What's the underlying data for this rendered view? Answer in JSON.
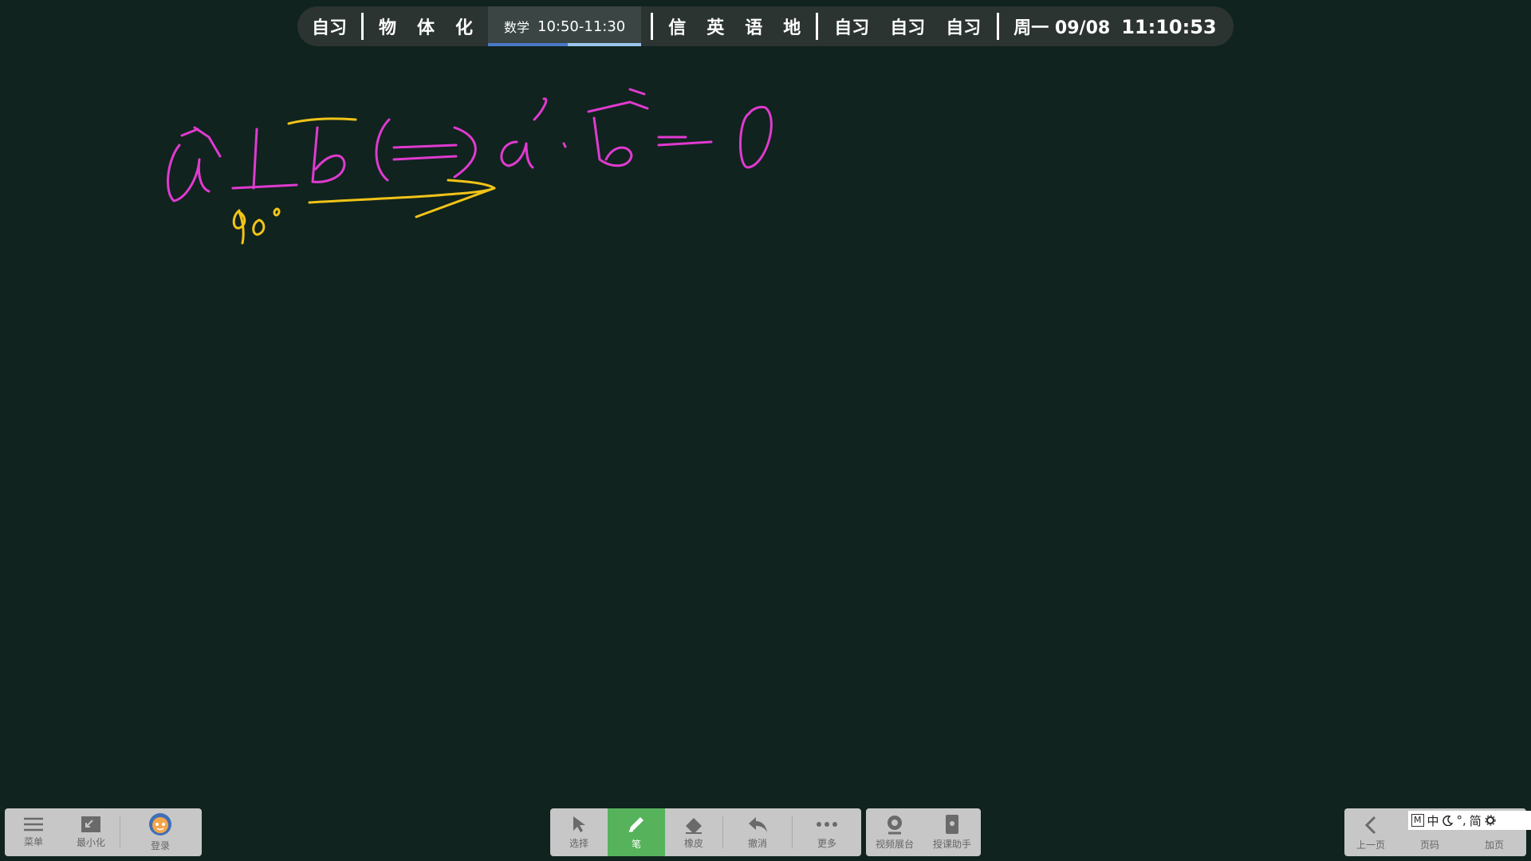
{
  "schedule": {
    "items_before": [
      "自习",
      "物",
      "体",
      "化"
    ],
    "current": {
      "subject": "数学",
      "time": "10:50-11:30",
      "progress": 0.52
    },
    "items_after": [
      "信",
      "英",
      "语",
      "地"
    ],
    "items_evening": [
      "自习",
      "自习",
      "自习"
    ],
    "date": "周一 09/08",
    "clock": "11:10:53"
  },
  "ink_colors": {
    "pink": "#e03ad0",
    "yellow": "#f2c418"
  },
  "left_toolbar": {
    "menu": {
      "label": "菜单",
      "icon": "hamburger-icon"
    },
    "minimize": {
      "label": "最小化",
      "icon": "minimize-icon"
    },
    "login": {
      "label": "登录",
      "icon": "avatar-icon"
    }
  },
  "center_toolbar": {
    "select": {
      "label": "选择",
      "icon": "cursor-icon"
    },
    "pen": {
      "label": "笔",
      "icon": "pen-icon",
      "active": true
    },
    "eraser": {
      "label": "橡皮",
      "icon": "eraser-icon"
    },
    "undo": {
      "label": "撤消",
      "icon": "undo-icon"
    },
    "more": {
      "label": "更多",
      "icon": "more-icon"
    },
    "camera": {
      "label": "视频展台",
      "icon": "webcam-icon"
    },
    "assistant": {
      "label": "授课助手",
      "icon": "phone-icon"
    }
  },
  "right_toolbar": {
    "prev": {
      "label": "上一页",
      "icon": "chevron-left-icon"
    },
    "page": {
      "label": "页码"
    },
    "add": {
      "label": "加页"
    }
  },
  "ime": {
    "mode": "M",
    "lang": "中",
    "punct": "°,",
    "script": "简",
    "icon": "gear-icon"
  },
  "accent": "#56b35c"
}
